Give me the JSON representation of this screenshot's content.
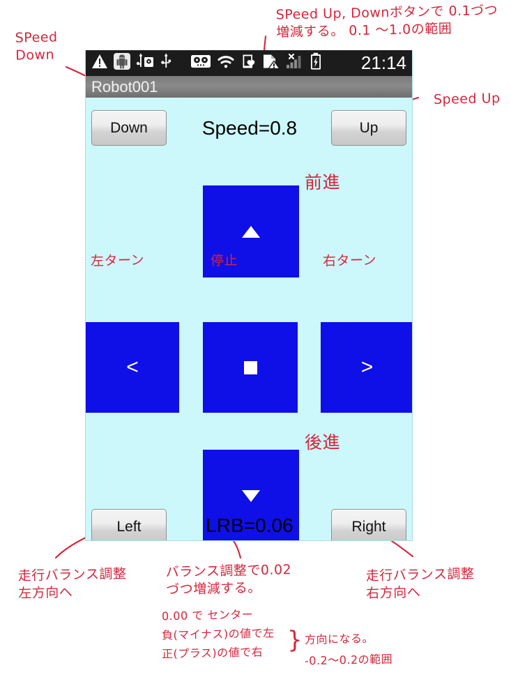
{
  "status_bar": {
    "icons": [
      "warning-triangle-icon",
      "android-debug-icon",
      "usb-storage-icon",
      "usb-icon",
      "tape-recorder-icon",
      "wifi-icon",
      "phone-heart-icon",
      "sd-card-warning-icon",
      "signal-bars-no-service-icon",
      "battery-charging-icon"
    ],
    "clock": "21:14"
  },
  "title_bar": {
    "title": "Robot001"
  },
  "controls": {
    "speed_down_label": "Down",
    "speed_up_label": "Up",
    "speed_readout": "Speed=0.8",
    "lrb_left_label": "Left",
    "lrb_right_label": "Right",
    "lrb_readout": "LRB=0.06",
    "forward_glyph": "triangle-up",
    "backward_glyph": "triangle-down",
    "left_glyph": "<",
    "right_glyph": ">",
    "stop_glyph": "square"
  },
  "colors": {
    "screen_background": "#ccf7fb",
    "pad_blue": "#0f0fe8",
    "annotation_red": "#d5263c",
    "status_bar": "#1c1c1c",
    "title_bar": "#7f7f7f"
  },
  "annotations": {
    "speed_down": "SPeed\nDown",
    "speed_up": "Speed Up",
    "speed_note": "SPeed Up, Downボタンで 0.1づつ\n増減する。 0.1 〜1.0の範囲",
    "forward": "前進",
    "backward": "後進",
    "left_turn": "左ターン",
    "stop": "停止",
    "right_turn": "右ターン",
    "balance_left": "走行バランス調整\n左方向へ",
    "balance_right": "走行バランス調整\n右方向へ",
    "lrb_note_1": "バランス調整で0.02\nづつ増減する。",
    "lrb_note_2": "0.00 で センター",
    "lrb_note_3": "負(マイナス)の値で左",
    "lrb_note_4": "正(プラス)の値で右",
    "lrb_note_5": "方向になる。",
    "lrb_note_6": "-0.2〜0.2の範囲",
    "brace": "}"
  }
}
